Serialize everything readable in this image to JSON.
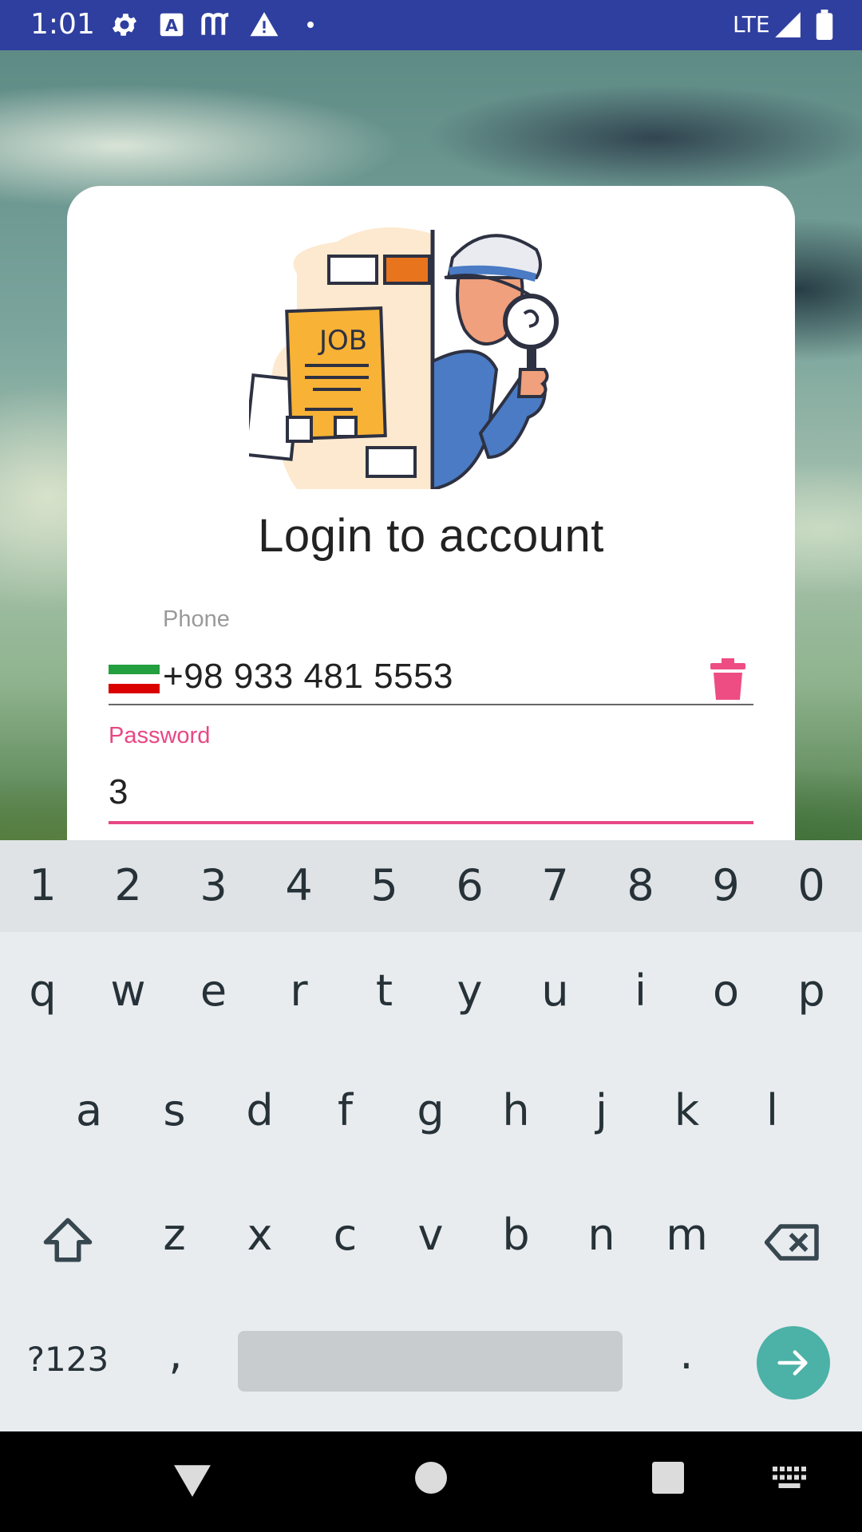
{
  "status_bar": {
    "time": "1:01",
    "network": "LTE",
    "icons": [
      "gear-icon",
      "a-icon",
      "m-icon",
      "warning-icon",
      "dot-icon",
      "signal-icon",
      "battery-icon"
    ]
  },
  "login": {
    "title": "Login to account",
    "illustration_text": "JOB",
    "phone": {
      "label": "Phone",
      "value": "+98 933 481 5553"
    },
    "password": {
      "label": "Password",
      "value": "3"
    }
  },
  "keyboard": {
    "number_row": [
      "1",
      "2",
      "3",
      "4",
      "5",
      "6",
      "7",
      "8",
      "9",
      "0"
    ],
    "row1": [
      "q",
      "w",
      "e",
      "r",
      "t",
      "y",
      "u",
      "i",
      "o",
      "p"
    ],
    "row2": [
      "a",
      "s",
      "d",
      "f",
      "g",
      "h",
      "j",
      "k",
      "l"
    ],
    "row3": [
      "z",
      "x",
      "c",
      "v",
      "b",
      "n",
      "m"
    ],
    "symbols_label": "?123",
    "comma": ",",
    "period": "."
  },
  "colors": {
    "status_bar": "#2f3f9f",
    "accent": "#e84784",
    "enter_key": "#4cb1a6"
  }
}
